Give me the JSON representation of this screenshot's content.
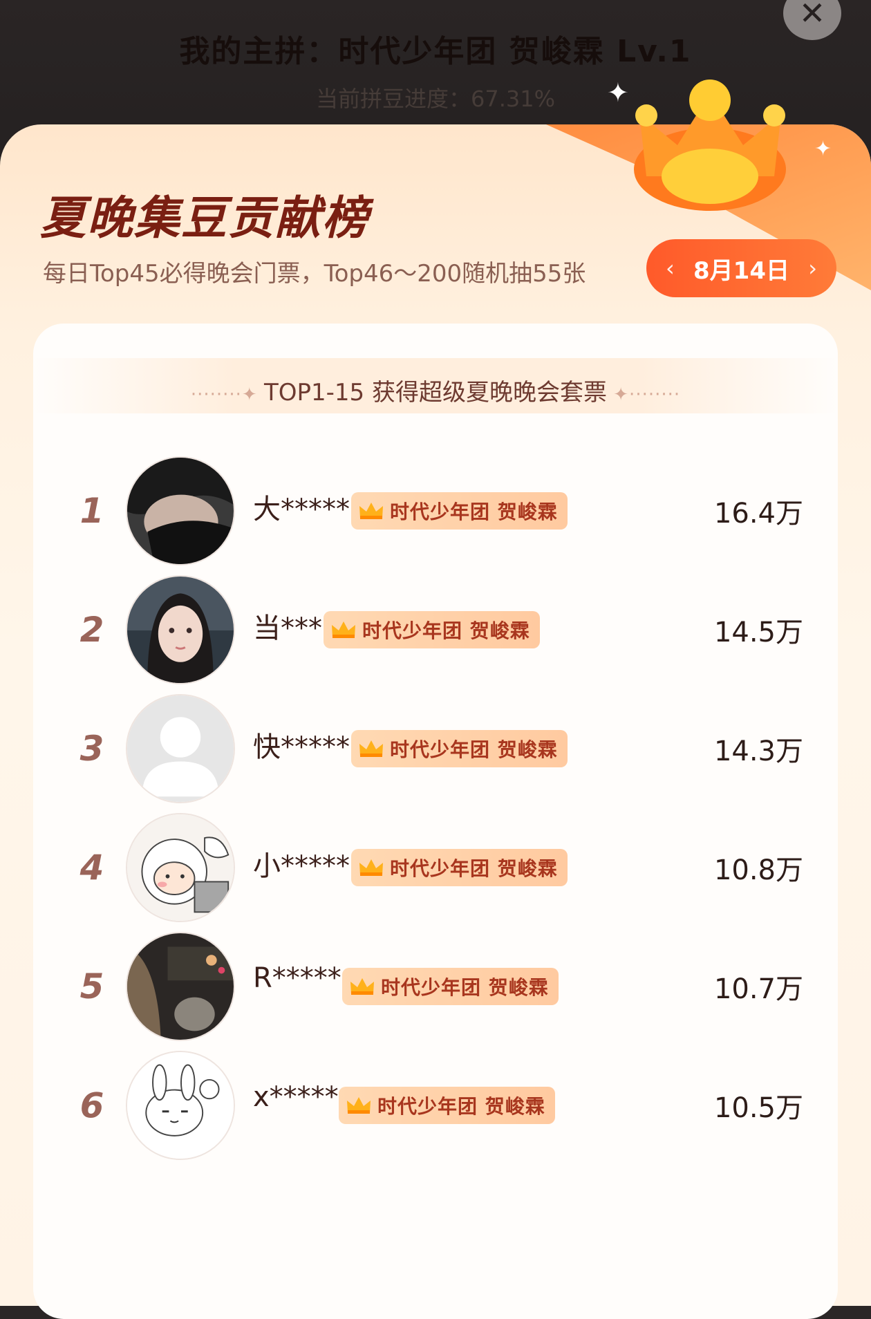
{
  "header": {
    "title": "我的主拼：时代少年团 贺峻霖 Lv.1",
    "progress_text": "当前拼豆进度：67.31%",
    "close_icon": "close-icon"
  },
  "board": {
    "title": "夏晚集豆贡献榜",
    "subtitle": "每日Top45必得晚会门票，Top46～200随机抽55张",
    "date": "8月14日"
  },
  "section": {
    "label": "TOP1-15 获得超级夏晚晚会套票"
  },
  "badge_text": "时代少年团 贺峻霖",
  "ranking": [
    {
      "rank": "1",
      "name": "大*****",
      "score": "16.4万",
      "avatar": "dark-hair-mask-avatar"
    },
    {
      "rank": "2",
      "name": "当***",
      "score": "14.5万",
      "avatar": "girl-portrait-avatar"
    },
    {
      "rank": "3",
      "name": "快*****",
      "score": "14.3万",
      "avatar": "default-user-avatar"
    },
    {
      "rank": "4",
      "name": "小*****",
      "score": "10.8万",
      "avatar": "cartoon-sheep-avatar"
    },
    {
      "rank": "5",
      "name": "R*****",
      "score": "10.7万",
      "avatar": "night-scene-avatar"
    },
    {
      "rank": "6",
      "name": "x*****",
      "score": "10.5万",
      "avatar": "sketch-rabbit-avatar"
    }
  ],
  "colors": {
    "accent": "#ff5a2a",
    "title": "#7a1f12",
    "badge_text": "#a8361e"
  }
}
